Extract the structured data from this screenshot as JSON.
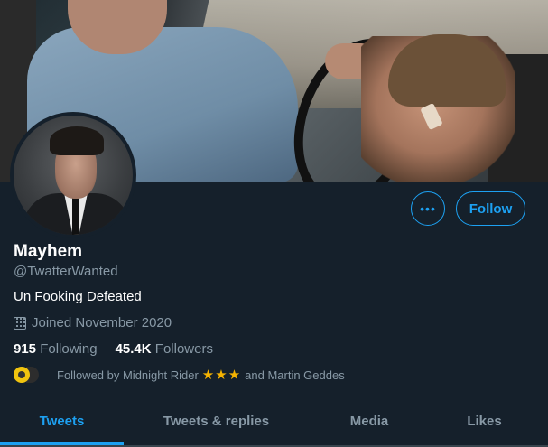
{
  "profile": {
    "name": "Mayhem",
    "handle": "@TwatterWanted",
    "bio": "Un Fooking Defeated",
    "joined": "Joined November 2020",
    "following_count": "915",
    "following_label": "Following",
    "followers_count": "45.4K",
    "followers_label": "Followers"
  },
  "actions": {
    "more_label": "•••",
    "follow_label": "Follow"
  },
  "followed_by": {
    "prefix": "Followed by Midnight Rider",
    "stars": "★★★",
    "suffix": "and Martin Geddes"
  },
  "tabs": [
    {
      "label": "Tweets",
      "active": true
    },
    {
      "label": "Tweets & replies",
      "active": false
    },
    {
      "label": "Media",
      "active": false
    },
    {
      "label": "Likes",
      "active": false
    }
  ],
  "colors": {
    "background": "#15202b",
    "accent": "#1da1f2",
    "secondary_text": "#8899a6"
  },
  "icons": [
    "calendar-icon",
    "more-icon",
    "follower-avatar-icon",
    "star-icon"
  ]
}
